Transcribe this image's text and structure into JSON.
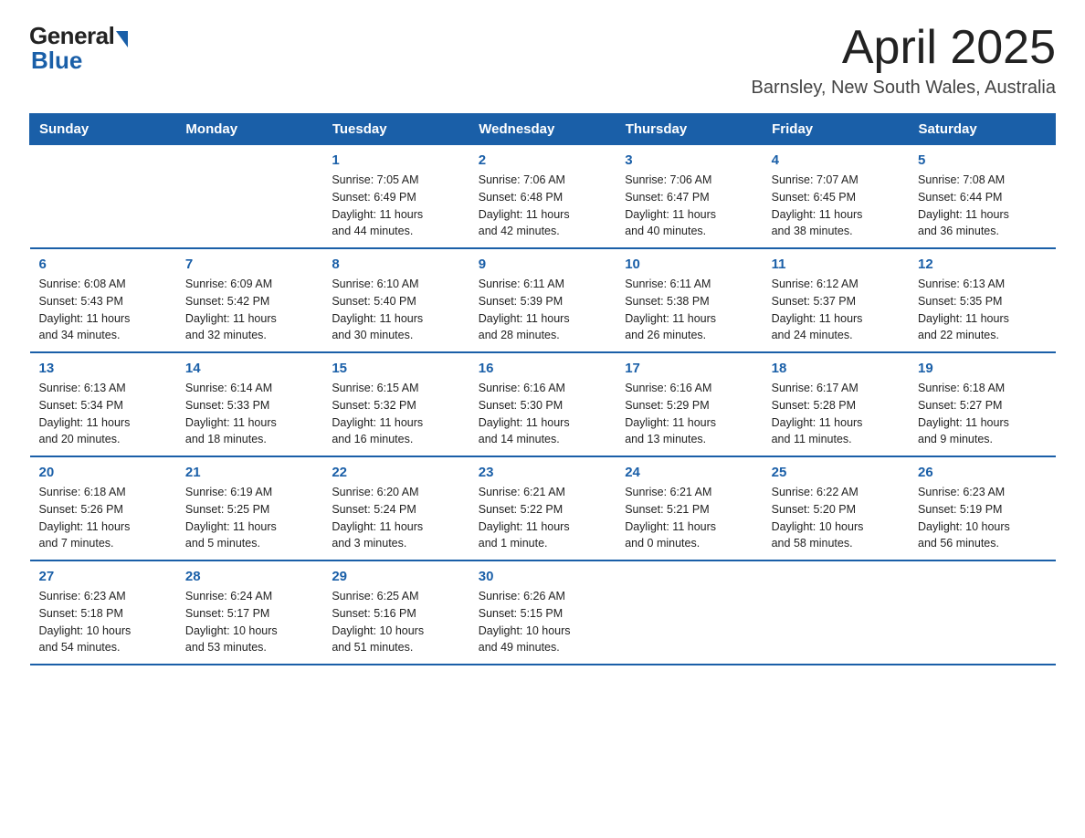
{
  "logo": {
    "general": "General",
    "blue": "Blue"
  },
  "title": {
    "month": "April 2025",
    "location": "Barnsley, New South Wales, Australia"
  },
  "weekdays": [
    "Sunday",
    "Monday",
    "Tuesday",
    "Wednesday",
    "Thursday",
    "Friday",
    "Saturday"
  ],
  "weeks": [
    [
      {
        "day": "",
        "info": ""
      },
      {
        "day": "",
        "info": ""
      },
      {
        "day": "1",
        "info": "Sunrise: 7:05 AM\nSunset: 6:49 PM\nDaylight: 11 hours\nand 44 minutes."
      },
      {
        "day": "2",
        "info": "Sunrise: 7:06 AM\nSunset: 6:48 PM\nDaylight: 11 hours\nand 42 minutes."
      },
      {
        "day": "3",
        "info": "Sunrise: 7:06 AM\nSunset: 6:47 PM\nDaylight: 11 hours\nand 40 minutes."
      },
      {
        "day": "4",
        "info": "Sunrise: 7:07 AM\nSunset: 6:45 PM\nDaylight: 11 hours\nand 38 minutes."
      },
      {
        "day": "5",
        "info": "Sunrise: 7:08 AM\nSunset: 6:44 PM\nDaylight: 11 hours\nand 36 minutes."
      }
    ],
    [
      {
        "day": "6",
        "info": "Sunrise: 6:08 AM\nSunset: 5:43 PM\nDaylight: 11 hours\nand 34 minutes."
      },
      {
        "day": "7",
        "info": "Sunrise: 6:09 AM\nSunset: 5:42 PM\nDaylight: 11 hours\nand 32 minutes."
      },
      {
        "day": "8",
        "info": "Sunrise: 6:10 AM\nSunset: 5:40 PM\nDaylight: 11 hours\nand 30 minutes."
      },
      {
        "day": "9",
        "info": "Sunrise: 6:11 AM\nSunset: 5:39 PM\nDaylight: 11 hours\nand 28 minutes."
      },
      {
        "day": "10",
        "info": "Sunrise: 6:11 AM\nSunset: 5:38 PM\nDaylight: 11 hours\nand 26 minutes."
      },
      {
        "day": "11",
        "info": "Sunrise: 6:12 AM\nSunset: 5:37 PM\nDaylight: 11 hours\nand 24 minutes."
      },
      {
        "day": "12",
        "info": "Sunrise: 6:13 AM\nSunset: 5:35 PM\nDaylight: 11 hours\nand 22 minutes."
      }
    ],
    [
      {
        "day": "13",
        "info": "Sunrise: 6:13 AM\nSunset: 5:34 PM\nDaylight: 11 hours\nand 20 minutes."
      },
      {
        "day": "14",
        "info": "Sunrise: 6:14 AM\nSunset: 5:33 PM\nDaylight: 11 hours\nand 18 minutes."
      },
      {
        "day": "15",
        "info": "Sunrise: 6:15 AM\nSunset: 5:32 PM\nDaylight: 11 hours\nand 16 minutes."
      },
      {
        "day": "16",
        "info": "Sunrise: 6:16 AM\nSunset: 5:30 PM\nDaylight: 11 hours\nand 14 minutes."
      },
      {
        "day": "17",
        "info": "Sunrise: 6:16 AM\nSunset: 5:29 PM\nDaylight: 11 hours\nand 13 minutes."
      },
      {
        "day": "18",
        "info": "Sunrise: 6:17 AM\nSunset: 5:28 PM\nDaylight: 11 hours\nand 11 minutes."
      },
      {
        "day": "19",
        "info": "Sunrise: 6:18 AM\nSunset: 5:27 PM\nDaylight: 11 hours\nand 9 minutes."
      }
    ],
    [
      {
        "day": "20",
        "info": "Sunrise: 6:18 AM\nSunset: 5:26 PM\nDaylight: 11 hours\nand 7 minutes."
      },
      {
        "day": "21",
        "info": "Sunrise: 6:19 AM\nSunset: 5:25 PM\nDaylight: 11 hours\nand 5 minutes."
      },
      {
        "day": "22",
        "info": "Sunrise: 6:20 AM\nSunset: 5:24 PM\nDaylight: 11 hours\nand 3 minutes."
      },
      {
        "day": "23",
        "info": "Sunrise: 6:21 AM\nSunset: 5:22 PM\nDaylight: 11 hours\nand 1 minute."
      },
      {
        "day": "24",
        "info": "Sunrise: 6:21 AM\nSunset: 5:21 PM\nDaylight: 11 hours\nand 0 minutes."
      },
      {
        "day": "25",
        "info": "Sunrise: 6:22 AM\nSunset: 5:20 PM\nDaylight: 10 hours\nand 58 minutes."
      },
      {
        "day": "26",
        "info": "Sunrise: 6:23 AM\nSunset: 5:19 PM\nDaylight: 10 hours\nand 56 minutes."
      }
    ],
    [
      {
        "day": "27",
        "info": "Sunrise: 6:23 AM\nSunset: 5:18 PM\nDaylight: 10 hours\nand 54 minutes."
      },
      {
        "day": "28",
        "info": "Sunrise: 6:24 AM\nSunset: 5:17 PM\nDaylight: 10 hours\nand 53 minutes."
      },
      {
        "day": "29",
        "info": "Sunrise: 6:25 AM\nSunset: 5:16 PM\nDaylight: 10 hours\nand 51 minutes."
      },
      {
        "day": "30",
        "info": "Sunrise: 6:26 AM\nSunset: 5:15 PM\nDaylight: 10 hours\nand 49 minutes."
      },
      {
        "day": "",
        "info": ""
      },
      {
        "day": "",
        "info": ""
      },
      {
        "day": "",
        "info": ""
      }
    ]
  ]
}
